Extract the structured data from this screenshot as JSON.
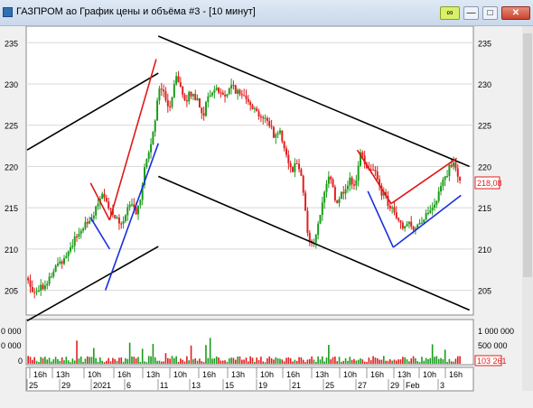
{
  "window": {
    "title": "ГАЗПРОМ ао График цены и объёма #3 - [10 минут]",
    "buttons": {
      "link": "∞",
      "minimize": "—",
      "maximize": "□",
      "close": "✕"
    }
  },
  "price_axis": {
    "ticks": [
      "235",
      "230",
      "225",
      "220",
      "215",
      "210",
      "205"
    ]
  },
  "price_values": [
    235,
    230,
    225,
    220,
    215,
    210,
    205
  ],
  "last_price": "218,08",
  "volume_axis": {
    "left_ticks": [
      "0 000",
      "0 000",
      "0"
    ],
    "right_ticks": [
      "1 000 000",
      "500 000",
      "0"
    ]
  },
  "last_volume": "103 261",
  "time_axis": {
    "hours": [
      "16h",
      "13h",
      "10h",
      "16h",
      "13h",
      "10h",
      "16h",
      "13h",
      "10h",
      "16h",
      "13h",
      "10h",
      "16h",
      "13h",
      "10h",
      "16h"
    ],
    "dates": [
      "25",
      "29",
      "2021",
      "6",
      "11",
      "13",
      "15",
      "19",
      "21",
      "25",
      "27",
      "29",
      "Feb",
      "3"
    ]
  },
  "colors": {
    "up": "#1c9c1c",
    "down": "#e02020",
    "trend_black": "#000000",
    "trend_red": "#e01818",
    "trend_blue": "#1a2ee0",
    "last_price": "#e02020"
  },
  "chart_data": {
    "type": "candlestick",
    "instrument": "ГАЗПРОМ ао",
    "timeframe": "10 минут",
    "ylim": [
      202,
      237
    ],
    "last_price": 218.08,
    "last_volume": 103261,
    "volume_ylim": [
      0,
      1100000
    ],
    "approx_close_path": [
      [
        0,
        206.5
      ],
      [
        2,
        205
      ],
      [
        5,
        205.3
      ],
      [
        8,
        205.6
      ],
      [
        11,
        206.5
      ],
      [
        14,
        208
      ],
      [
        16,
        208.5
      ],
      [
        19,
        209.5
      ],
      [
        22,
        211
      ],
      [
        25,
        212
      ],
      [
        27,
        213
      ],
      [
        29,
        213.5
      ],
      [
        31,
        214
      ],
      [
        33,
        215
      ],
      [
        35,
        216.5
      ],
      [
        37,
        215.8
      ],
      [
        39,
        214.5
      ],
      [
        41,
        214.5
      ],
      [
        43,
        213
      ],
      [
        45,
        213.5
      ],
      [
        47,
        214.5
      ],
      [
        49,
        215.5
      ],
      [
        51,
        214.5
      ],
      [
        53,
        215
      ],
      [
        55,
        219
      ],
      [
        57,
        221.5
      ],
      [
        59,
        223
      ],
      [
        61,
        227
      ],
      [
        63,
        230
      ],
      [
        65,
        229
      ],
      [
        67,
        226.5
      ],
      [
        69,
        229
      ],
      [
        71,
        231
      ],
      [
        73,
        229
      ],
      [
        75,
        227.5
      ],
      [
        77,
        229
      ],
      [
        79,
        228.5
      ],
      [
        81,
        228
      ],
      [
        83,
        226
      ],
      [
        85,
        228
      ],
      [
        87,
        229
      ],
      [
        89,
        229.5
      ],
      [
        91,
        229
      ],
      [
        93,
        228.5
      ],
      [
        95,
        229
      ],
      [
        97,
        230
      ],
      [
        99,
        229
      ],
      [
        101,
        228.5
      ],
      [
        103,
        228.8
      ],
      [
        105,
        228
      ],
      [
        107,
        227
      ],
      [
        109,
        226.5
      ],
      [
        111,
        226
      ],
      [
        113,
        225.5
      ],
      [
        115,
        225
      ],
      [
        117,
        223.5
      ],
      [
        119,
        224.5
      ],
      [
        121,
        223
      ],
      [
        123,
        221
      ],
      [
        125,
        219.5
      ],
      [
        127,
        220.5
      ],
      [
        129,
        219.8
      ],
      [
        131,
        216
      ],
      [
        133,
        211
      ],
      [
        135,
        210.5
      ],
      [
        137,
        212
      ],
      [
        139,
        215
      ],
      [
        141,
        217
      ],
      [
        143,
        219.5
      ],
      [
        145,
        216.5
      ],
      [
        147,
        215.5
      ],
      [
        149,
        217
      ],
      [
        151,
        217.5
      ],
      [
        153,
        218.5
      ],
      [
        155,
        217
      ],
      [
        157,
        221.5
      ],
      [
        159,
        221
      ],
      [
        161,
        220
      ],
      [
        163,
        219.5
      ],
      [
        165,
        218.8
      ],
      [
        167,
        217
      ],
      [
        169,
        216.5
      ],
      [
        171,
        215
      ],
      [
        173,
        214.5
      ],
      [
        175,
        213.5
      ],
      [
        177,
        212.5
      ],
      [
        179,
        212.8
      ],
      [
        181,
        213
      ],
      [
        183,
        212.5
      ],
      [
        185,
        213.2
      ],
      [
        187,
        213.6
      ],
      [
        189,
        214
      ],
      [
        191,
        214.5
      ],
      [
        193,
        215.5
      ],
      [
        195,
        217
      ],
      [
        197,
        218.5
      ],
      [
        199,
        219.5
      ],
      [
        201,
        220.5
      ],
      [
        203,
        219.5
      ],
      [
        205,
        218.08
      ]
    ],
    "trendlines": [
      {
        "color": "black",
        "from": [
          0,
          222
        ],
        "to": [
          62,
          231.3
        ]
      },
      {
        "color": "black",
        "from": [
          0,
          201.3
        ],
        "to": [
          62,
          210.3
        ]
      },
      {
        "color": "black",
        "from": [
          62,
          235.8
        ],
        "to": [
          209,
          220
        ]
      },
      {
        "color": "black",
        "from": [
          62,
          218.8
        ],
        "to": [
          209,
          202.6
        ]
      },
      {
        "color": "red",
        "from": [
          30,
          218
        ],
        "to": [
          39,
          213.5
        ]
      },
      {
        "color": "red",
        "from": [
          39,
          213.5
        ],
        "to": [
          61,
          233
        ]
      },
      {
        "color": "blue",
        "from": [
          30,
          213.8
        ],
        "to": [
          39,
          210
        ]
      },
      {
        "color": "blue",
        "from": [
          37,
          205
        ],
        "to": [
          62,
          222.8
        ]
      },
      {
        "color": "red",
        "from": [
          156,
          222
        ],
        "to": [
          172,
          215.5
        ]
      },
      {
        "color": "red",
        "from": [
          172,
          215.5
        ],
        "to": [
          203,
          221
        ]
      },
      {
        "color": "blue",
        "from": [
          161,
          217
        ],
        "to": [
          173,
          210.2
        ]
      },
      {
        "color": "blue",
        "from": [
          173,
          210.2
        ],
        "to": [
          205,
          216.5
        ]
      }
    ]
  }
}
